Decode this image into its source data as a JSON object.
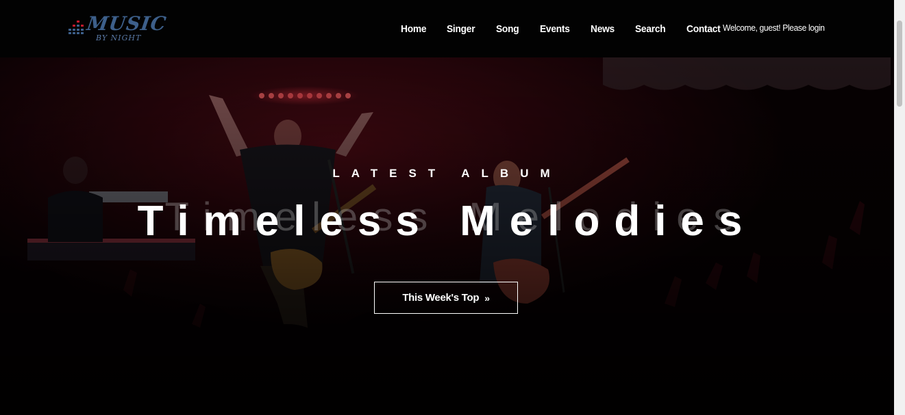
{
  "brand": {
    "word1": "MUSIC",
    "word2": "BY NIGHT",
    "color": "#3d5f8a"
  },
  "nav": {
    "items": [
      {
        "label": "Home"
      },
      {
        "label": "Singer"
      },
      {
        "label": "Song"
      },
      {
        "label": "Events"
      },
      {
        "label": "News"
      },
      {
        "label": "Search"
      },
      {
        "label": "Contact"
      }
    ],
    "welcome": "Welcome, guest! Please login"
  },
  "hero": {
    "kicker": "LATEST ALBUM",
    "title": "Timeless Melodies",
    "button_label": "This Week's Top",
    "button_icon": "double-chevron-right-icon",
    "accent_color": "#c0101c"
  }
}
